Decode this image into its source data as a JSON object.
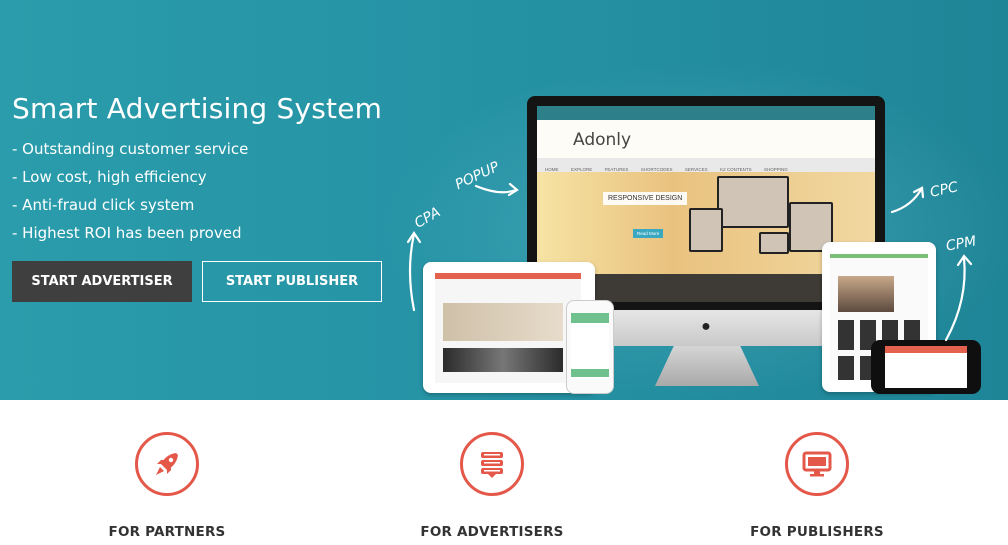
{
  "hero": {
    "title": "Smart Advertising System",
    "features": [
      "- Outstanding customer service",
      "- Low cost, high efficiency",
      "- Anti-fraud click system",
      "- Highest ROI has been proved"
    ],
    "buttons": {
      "advertiser": "START ADVERTISER",
      "publisher": "START PUBLISHER"
    },
    "arrow_labels": {
      "popup": "POPUP",
      "cpa": "CPA",
      "cpc": "CPC",
      "cpm": "CPM"
    }
  },
  "mockup": {
    "site_logo": "Adonly",
    "banner_title": "RESPONSIVE DESIGN",
    "banner_button": "Read More",
    "nav_items": [
      "HOME",
      "EXPLORE",
      "FEATURES",
      "SHORTCODES",
      "SERVICES",
      "K2 CONTENTS",
      "SHOPPING"
    ]
  },
  "features": [
    {
      "label": "FOR PARTNERS",
      "icon": "rocket-icon"
    },
    {
      "label": "FOR ADVERTISERS",
      "icon": "ad-list-icon"
    },
    {
      "label": "FOR PUBLISHERS",
      "icon": "monitor-icon"
    }
  ],
  "colors": {
    "hero_bg": "#2592a4",
    "accent": "#e4584a",
    "dark_button": "#3f3f3f"
  }
}
